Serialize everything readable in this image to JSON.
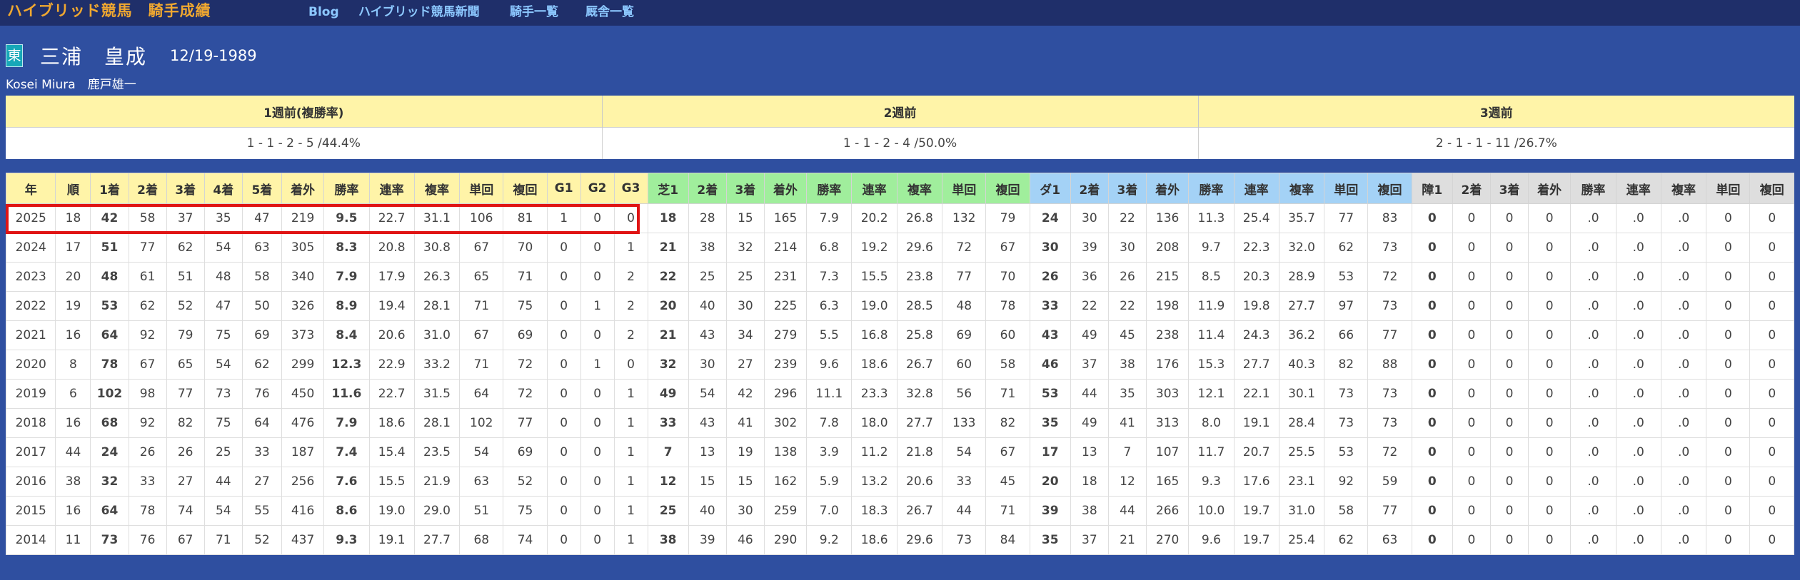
{
  "site": {
    "title": "ハイブリッド競馬　騎手成績"
  },
  "nav": [
    {
      "label": "Blog"
    },
    {
      "label": "ハイブリッド競馬新聞"
    },
    {
      "label": "騎手一覧"
    },
    {
      "label": "厩舎一覧"
    }
  ],
  "jockey": {
    "region_badge": "東",
    "name": "三浦　皇成",
    "birthdate": "12/19-1989",
    "name_en": "Kosei Miura",
    "stable": "鹿戸雄一"
  },
  "colors": {
    "all_header": "#fff4a8",
    "turf_header": "#a0ee9c",
    "dirt_header": "#a4d2f6",
    "jump_header": "#dedede",
    "highlight": "#e01414",
    "page_bg": "#2f4fa0"
  },
  "recent_form": {
    "headers": [
      "1週前(複勝率)",
      "2週前",
      "3週前"
    ],
    "values": [
      "1 - 1 - 2 - 5 /44.4%",
      "1 - 1 - 2 - 4 /50.0%",
      "2 - 1 - 1 - 11 /26.7%"
    ]
  },
  "stats_table": {
    "headers": [
      "年",
      "順",
      "1着",
      "2着",
      "3着",
      "4着",
      "5着",
      "着外",
      "勝率",
      "連率",
      "複率",
      "単回",
      "複回",
      "G1",
      "G2",
      "G3",
      "芝1",
      "2着",
      "3着",
      "着外",
      "勝率",
      "連率",
      "複率",
      "単回",
      "複回",
      "ダ1",
      "2着",
      "3着",
      "着外",
      "勝率",
      "連率",
      "複率",
      "単回",
      "複回",
      "障1",
      "2着",
      "3着",
      "着外",
      "勝率",
      "連率",
      "複率",
      "単回",
      "複回"
    ],
    "highlighted_year": "2025",
    "rows": [
      [
        "2025",
        "18",
        "42",
        "58",
        "37",
        "35",
        "47",
        "219",
        "9.5",
        "22.7",
        "31.1",
        "106",
        "81",
        "1",
        "0",
        "0",
        "18",
        "28",
        "15",
        "165",
        "7.9",
        "20.2",
        "26.8",
        "132",
        "79",
        "24",
        "30",
        "22",
        "136",
        "11.3",
        "25.4",
        "35.7",
        "77",
        "83",
        "0",
        "0",
        "0",
        "0",
        ".0",
        ".0",
        ".0",
        "0",
        "0"
      ],
      [
        "2024",
        "17",
        "51",
        "77",
        "62",
        "54",
        "63",
        "305",
        "8.3",
        "20.8",
        "30.8",
        "67",
        "70",
        "0",
        "0",
        "1",
        "21",
        "38",
        "32",
        "214",
        "6.8",
        "19.2",
        "29.6",
        "72",
        "67",
        "30",
        "39",
        "30",
        "208",
        "9.7",
        "22.3",
        "32.0",
        "62",
        "73",
        "0",
        "0",
        "0",
        "0",
        ".0",
        ".0",
        ".0",
        "0",
        "0"
      ],
      [
        "2023",
        "20",
        "48",
        "61",
        "51",
        "48",
        "58",
        "340",
        "7.9",
        "17.9",
        "26.3",
        "65",
        "71",
        "0",
        "0",
        "2",
        "22",
        "25",
        "25",
        "231",
        "7.3",
        "15.5",
        "23.8",
        "77",
        "70",
        "26",
        "36",
        "26",
        "215",
        "8.5",
        "20.3",
        "28.9",
        "53",
        "72",
        "0",
        "0",
        "0",
        "0",
        ".0",
        ".0",
        ".0",
        "0",
        "0"
      ],
      [
        "2022",
        "19",
        "53",
        "62",
        "52",
        "47",
        "50",
        "326",
        "8.9",
        "19.4",
        "28.1",
        "71",
        "75",
        "0",
        "1",
        "2",
        "20",
        "40",
        "30",
        "225",
        "6.3",
        "19.0",
        "28.5",
        "48",
        "78",
        "33",
        "22",
        "22",
        "198",
        "11.9",
        "19.8",
        "27.7",
        "97",
        "73",
        "0",
        "0",
        "0",
        "0",
        ".0",
        ".0",
        ".0",
        "0",
        "0"
      ],
      [
        "2021",
        "16",
        "64",
        "92",
        "79",
        "75",
        "69",
        "373",
        "8.4",
        "20.6",
        "31.0",
        "67",
        "69",
        "0",
        "0",
        "2",
        "21",
        "43",
        "34",
        "279",
        "5.5",
        "16.8",
        "25.8",
        "69",
        "60",
        "43",
        "49",
        "45",
        "238",
        "11.4",
        "24.3",
        "36.2",
        "66",
        "77",
        "0",
        "0",
        "0",
        "0",
        ".0",
        ".0",
        ".0",
        "0",
        "0"
      ],
      [
        "2020",
        "8",
        "78",
        "67",
        "65",
        "54",
        "62",
        "299",
        "12.3",
        "22.9",
        "33.2",
        "71",
        "72",
        "0",
        "1",
        "0",
        "32",
        "30",
        "27",
        "239",
        "9.6",
        "18.6",
        "26.7",
        "60",
        "58",
        "46",
        "37",
        "38",
        "176",
        "15.3",
        "27.7",
        "40.3",
        "82",
        "88",
        "0",
        "0",
        "0",
        "0",
        ".0",
        ".0",
        ".0",
        "0",
        "0"
      ],
      [
        "2019",
        "6",
        "102",
        "98",
        "77",
        "73",
        "76",
        "450",
        "11.6",
        "22.7",
        "31.5",
        "64",
        "72",
        "0",
        "0",
        "1",
        "49",
        "54",
        "42",
        "296",
        "11.1",
        "23.3",
        "32.8",
        "56",
        "71",
        "53",
        "44",
        "35",
        "303",
        "12.1",
        "22.1",
        "30.1",
        "73",
        "73",
        "0",
        "0",
        "0",
        "0",
        ".0",
        ".0",
        ".0",
        "0",
        "0"
      ],
      [
        "2018",
        "16",
        "68",
        "92",
        "82",
        "75",
        "64",
        "476",
        "7.9",
        "18.6",
        "28.1",
        "102",
        "77",
        "0",
        "0",
        "1",
        "33",
        "43",
        "41",
        "302",
        "7.8",
        "18.0",
        "27.7",
        "133",
        "82",
        "35",
        "49",
        "41",
        "313",
        "8.0",
        "19.1",
        "28.4",
        "73",
        "73",
        "0",
        "0",
        "0",
        "0",
        ".0",
        ".0",
        ".0",
        "0",
        "0"
      ],
      [
        "2017",
        "44",
        "24",
        "26",
        "26",
        "25",
        "33",
        "187",
        "7.4",
        "15.4",
        "23.5",
        "54",
        "69",
        "0",
        "0",
        "1",
        "7",
        "13",
        "19",
        "138",
        "3.9",
        "11.2",
        "21.8",
        "54",
        "67",
        "17",
        "13",
        "7",
        "107",
        "11.7",
        "20.7",
        "25.5",
        "53",
        "72",
        "0",
        "0",
        "0",
        "0",
        ".0",
        ".0",
        ".0",
        "0",
        "0"
      ],
      [
        "2016",
        "38",
        "32",
        "33",
        "27",
        "44",
        "27",
        "256",
        "7.6",
        "15.5",
        "21.9",
        "63",
        "52",
        "0",
        "0",
        "1",
        "12",
        "15",
        "15",
        "162",
        "5.9",
        "13.2",
        "20.6",
        "33",
        "45",
        "20",
        "18",
        "12",
        "165",
        "9.3",
        "17.6",
        "23.1",
        "92",
        "59",
        "0",
        "0",
        "0",
        "0",
        ".0",
        ".0",
        ".0",
        "0",
        "0"
      ],
      [
        "2015",
        "16",
        "64",
        "78",
        "74",
        "54",
        "55",
        "416",
        "8.6",
        "19.0",
        "29.0",
        "51",
        "75",
        "0",
        "0",
        "1",
        "25",
        "40",
        "30",
        "259",
        "7.0",
        "18.3",
        "26.7",
        "44",
        "71",
        "39",
        "38",
        "44",
        "266",
        "10.0",
        "19.7",
        "31.0",
        "58",
        "77",
        "0",
        "0",
        "0",
        "0",
        ".0",
        ".0",
        ".0",
        "0",
        "0"
      ],
      [
        "2014",
        "11",
        "73",
        "76",
        "67",
        "71",
        "52",
        "437",
        "9.3",
        "19.1",
        "27.7",
        "68",
        "74",
        "0",
        "0",
        "1",
        "38",
        "39",
        "46",
        "290",
        "9.2",
        "18.6",
        "29.6",
        "73",
        "84",
        "35",
        "37",
        "21",
        "270",
        "9.6",
        "19.7",
        "25.4",
        "62",
        "63",
        "0",
        "0",
        "0",
        "0",
        ".0",
        ".0",
        ".0",
        "0",
        "0"
      ]
    ]
  }
}
